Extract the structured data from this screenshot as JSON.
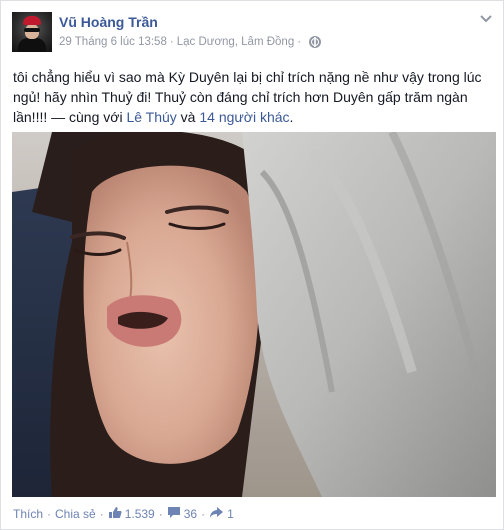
{
  "post": {
    "author": "Vũ Hoàng Trần",
    "timestamp": "29 Tháng 6 lúc 13:58",
    "separator": "·",
    "location": "Lạc Dương, Lâm Đồng",
    "privacy_icon": "globe-icon",
    "menu_icon": "chevron-down-icon",
    "text": "tôi chẳng hiểu vì sao mà Kỳ Duyên lại bị chỉ trích nặng nề như vậy trong lúc ngủ! hãy nhìn Thuỷ đi! Thuỷ còn đáng chỉ trích hơn Duyên gấp trăm ngàn lần!!!! — cùng với ",
    "tagged_person": "Lê Thúy",
    "conjunction": " và ",
    "tagged_others": "14 người khác",
    "text_end": "."
  },
  "actions": {
    "like_label": "Thích",
    "share_label": "Chia sẻ",
    "dot": "·",
    "likes_count": "1.539",
    "comments_count": "36",
    "shares_count": "1",
    "like_icon": "thumbs-up-icon",
    "comment_icon": "comment-icon",
    "share_icon": "share-arrow-icon"
  },
  "colors": {
    "link": "#3b5998",
    "action_link": "#6d84b4",
    "meta": "#9197a3",
    "text": "#141823"
  }
}
